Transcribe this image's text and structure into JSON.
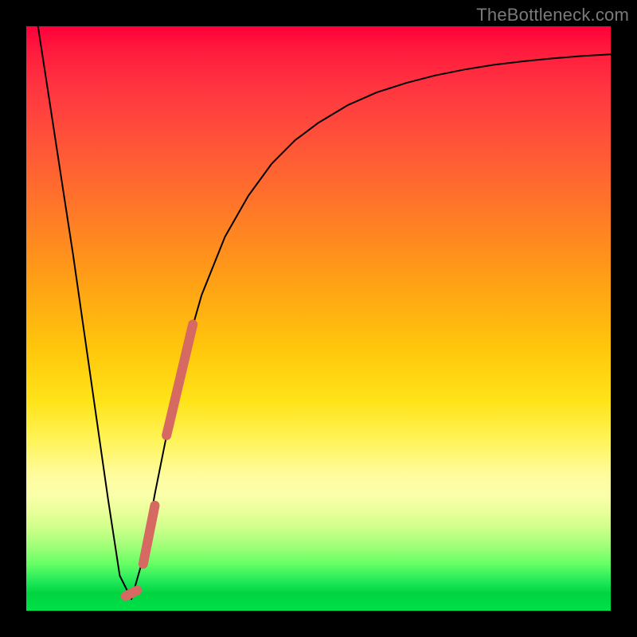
{
  "watermark": {
    "text": "TheBottleneck.com"
  },
  "colors": {
    "curve_stroke": "#000000",
    "segment_stroke": "#d66a63",
    "background": "#000000"
  },
  "chart_data": {
    "type": "line",
    "title": "",
    "xlabel": "",
    "ylabel": "",
    "xlim": [
      0,
      100
    ],
    "ylim": [
      0,
      100
    ],
    "grid": false,
    "annotations": [],
    "series": [
      {
        "name": "curve",
        "x": [
          2,
          4,
          6,
          8,
          10,
          12,
          14,
          16,
          18,
          20,
          22,
          24,
          26,
          28,
          30,
          34,
          38,
          42,
          46,
          50,
          55,
          60,
          65,
          70,
          75,
          80,
          85,
          90,
          95,
          100
        ],
        "y": [
          100,
          87,
          74,
          61,
          47,
          33,
          19,
          6,
          2,
          9,
          20,
          30,
          39,
          47,
          54,
          64,
          71,
          76.5,
          80.5,
          83.5,
          86.5,
          88.7,
          90.3,
          91.6,
          92.6,
          93.4,
          94.0,
          94.5,
          94.9,
          95.2
        ]
      }
    ],
    "highlight_segments": [
      {
        "name": "thick-segment-upper",
        "endpoints": [
          {
            "x": 24.0,
            "y": 30.0
          },
          {
            "x": 28.5,
            "y": 49.0
          }
        ],
        "width": 12
      },
      {
        "name": "thick-segment-lower",
        "endpoints": [
          {
            "x": 20.0,
            "y": 8.0
          },
          {
            "x": 22.0,
            "y": 18.0
          }
        ],
        "width": 12
      },
      {
        "name": "dot-trough",
        "endpoints": [
          {
            "x": 17.0,
            "y": 2.5
          },
          {
            "x": 19.0,
            "y": 3.5
          }
        ],
        "width": 12
      }
    ]
  }
}
